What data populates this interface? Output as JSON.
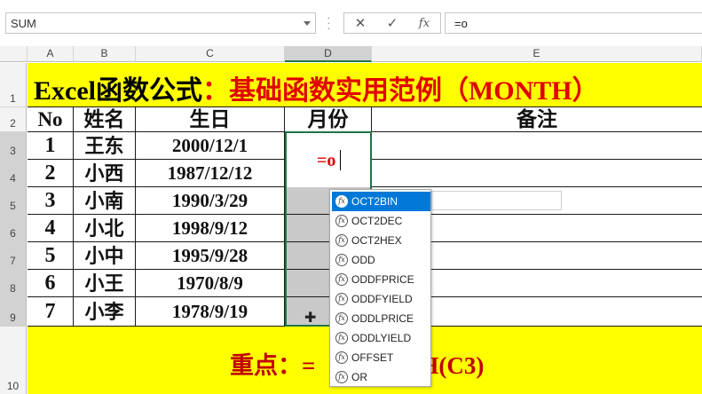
{
  "name_box": "SUM",
  "formula_buttons": {
    "cancel": "✕",
    "enter": "✓",
    "fx": "fx"
  },
  "formula_input": "=o",
  "columns": [
    "A",
    "B",
    "C",
    "D",
    "E"
  ],
  "rows": [
    "1",
    "2",
    "3",
    "4",
    "5",
    "6",
    "7",
    "8",
    "9",
    "10"
  ],
  "title_black": "Excel函数公式",
  "title_red": "：基础函数实用范例（MONTH）",
  "headers": {
    "no": "No",
    "name": "姓名",
    "birth": "生日",
    "month": "月份",
    "note": "备注"
  },
  "records": [
    {
      "no": "1",
      "name": "王东",
      "birth": "2000/12/1"
    },
    {
      "no": "2",
      "name": "小西",
      "birth": "1987/12/12"
    },
    {
      "no": "3",
      "name": "小南",
      "birth": "1990/3/29"
    },
    {
      "no": "4",
      "name": "小北",
      "birth": "1998/9/12"
    },
    {
      "no": "5",
      "name": "小中",
      "birth": "1995/9/28"
    },
    {
      "no": "6",
      "name": "小王",
      "birth": "1970/8/9"
    },
    {
      "no": "7",
      "name": "小李",
      "birth": "1978/9/19"
    }
  ],
  "active_cell_text": "=o",
  "bottom_text": "重点：=",
  "bottom_text_right": "H(C3)",
  "autocomplete": [
    "OCT2BIN",
    "OCT2DEC",
    "OCT2HEX",
    "ODD",
    "ODDFPRICE",
    "ODDFYIELD",
    "ODDLPRICE",
    "ODDLYIELD",
    "OFFSET",
    "OR"
  ],
  "icons": {
    "fx": "function-icon"
  }
}
